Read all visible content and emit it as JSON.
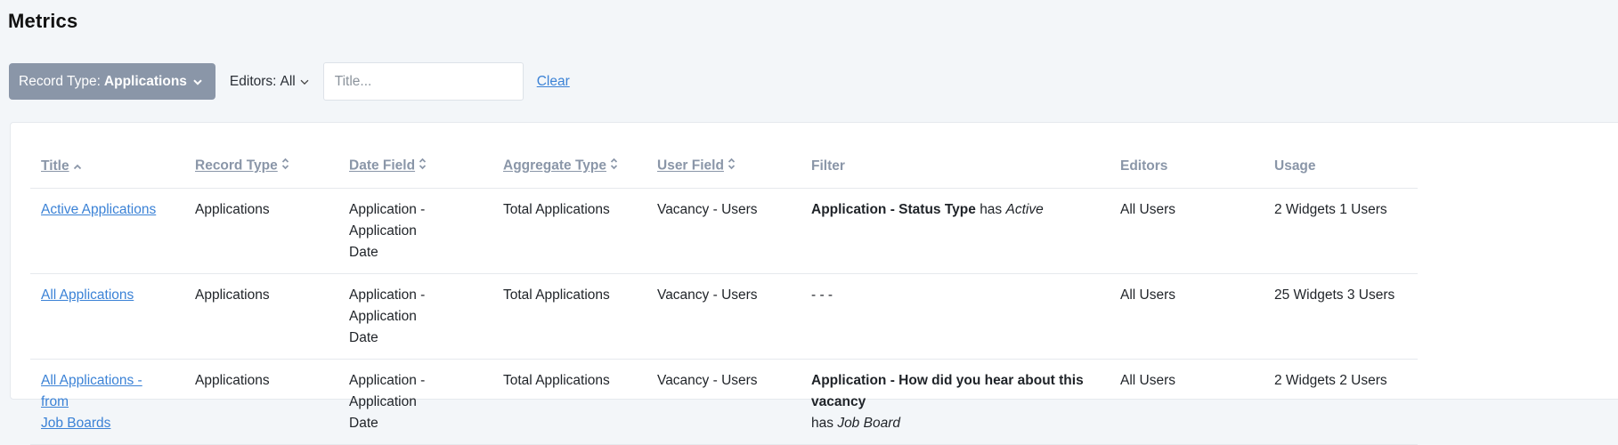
{
  "page": {
    "title": "Metrics"
  },
  "filters": {
    "record_type_label": "Record Type:",
    "record_type_value": "Applications",
    "editors_label": "Editors:",
    "editors_value": "All",
    "title_placeholder": "Title...",
    "title_value": "",
    "clear_label": "Clear"
  },
  "table": {
    "headers": {
      "title": "Title",
      "record_type": "Record Type",
      "date_field": "Date Field",
      "aggregate_type": "Aggregate Type",
      "user_field": "User Field",
      "filter": "Filter",
      "editors": "Editors",
      "usage": "Usage"
    },
    "sort": {
      "column": "title",
      "direction": "ascending"
    },
    "rows": [
      {
        "title_line1": "Active Applications",
        "title_line2": "",
        "record_type": "Applications",
        "date_field_line1": "Application - Application",
        "date_field_line2": "Date",
        "aggregate_type": "Total Applications",
        "user_field": "Vacancy - Users",
        "filter_field": "Application - Status Type",
        "filter_op": "has",
        "filter_value": "Active",
        "editors": "All Users",
        "usage": "2 Widgets 1 Users"
      },
      {
        "title_line1": "All Applications",
        "title_line2": "",
        "record_type": "Applications",
        "date_field_line1": "Application - Application",
        "date_field_line2": "Date",
        "aggregate_type": "Total Applications",
        "user_field": "Vacancy - Users",
        "filter_text": "- - -",
        "editors": "All Users",
        "usage": "25 Widgets 3 Users"
      },
      {
        "title_line1": "All Applications - from",
        "title_line2": "Job Boards",
        "record_type": "Applications",
        "date_field_line1": "Application - Application",
        "date_field_line2": "Date",
        "aggregate_type": "Total Applications",
        "user_field": "Vacancy - Users",
        "filter_field": "Application - How did you hear about this vacancy",
        "filter_op": "has",
        "filter_value": "Job Board",
        "editors": "All Users",
        "usage": "2 Widgets 2 Users"
      }
    ]
  },
  "colors": {
    "background": "#f3f6f9",
    "record_type_button": "#8a96a8",
    "link": "#3b82d6",
    "header_text": "#8a96a8"
  },
  "icons": {
    "record_type_chevron": "chevron-down-icon",
    "editors_chevron": "chevron-down-icon",
    "title_sort": "sort-ascending-icon",
    "other_sort": "sort-both-icon"
  }
}
